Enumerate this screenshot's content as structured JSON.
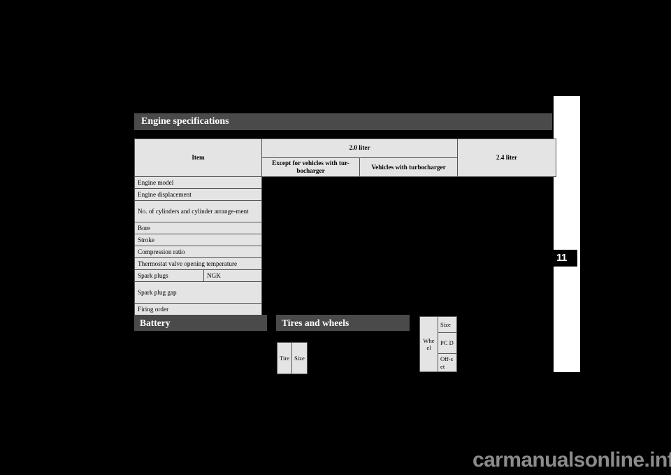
{
  "page": {
    "background_color": "#000000",
    "sidebar_color": "#ffffff",
    "bar_color": "#4a4a4a",
    "table_cell_color": "#e4e4e4"
  },
  "chapter_tab": {
    "label": "11"
  },
  "sections": {
    "engine": {
      "title": "Engine specifications"
    },
    "battery": {
      "title": "Battery"
    },
    "tires": {
      "title": "Tires and wheels"
    }
  },
  "engine_table": {
    "header": {
      "item": "Item",
      "group_2_0": "2.0 liter",
      "sub_except_turbo": "Except for vehicles with tur-bocharger",
      "sub_with_turbo": "Vehicles with turbocharger",
      "group_2_4": "2.4 liter"
    },
    "rows": [
      {
        "label": "Engine model",
        "sub": ""
      },
      {
        "label": "Engine displacement",
        "sub": ""
      },
      {
        "label": "No. of cylinders and cylinder arrange-ment",
        "sub": ""
      },
      {
        "label": "Bore",
        "sub": ""
      },
      {
        "label": "Stroke",
        "sub": ""
      },
      {
        "label": "Compression ratio",
        "sub": ""
      },
      {
        "label": "Thermostat valve opening temperature",
        "sub": ""
      },
      {
        "label": "Spark plugs",
        "sub": "NGK"
      },
      {
        "label": "Spark plug gap",
        "sub": ""
      },
      {
        "label": "Firing order",
        "sub": ""
      }
    ]
  },
  "tire_table": {
    "cells": [
      {
        "label": "Tire"
      },
      {
        "label": "Size"
      }
    ]
  },
  "wheel_table": {
    "label": "Wheel",
    "rows": [
      {
        "label": "Size"
      },
      {
        "label": "PC D"
      },
      {
        "label": "Off-set"
      }
    ]
  },
  "watermark": {
    "text": "carmanualsonline.info"
  }
}
